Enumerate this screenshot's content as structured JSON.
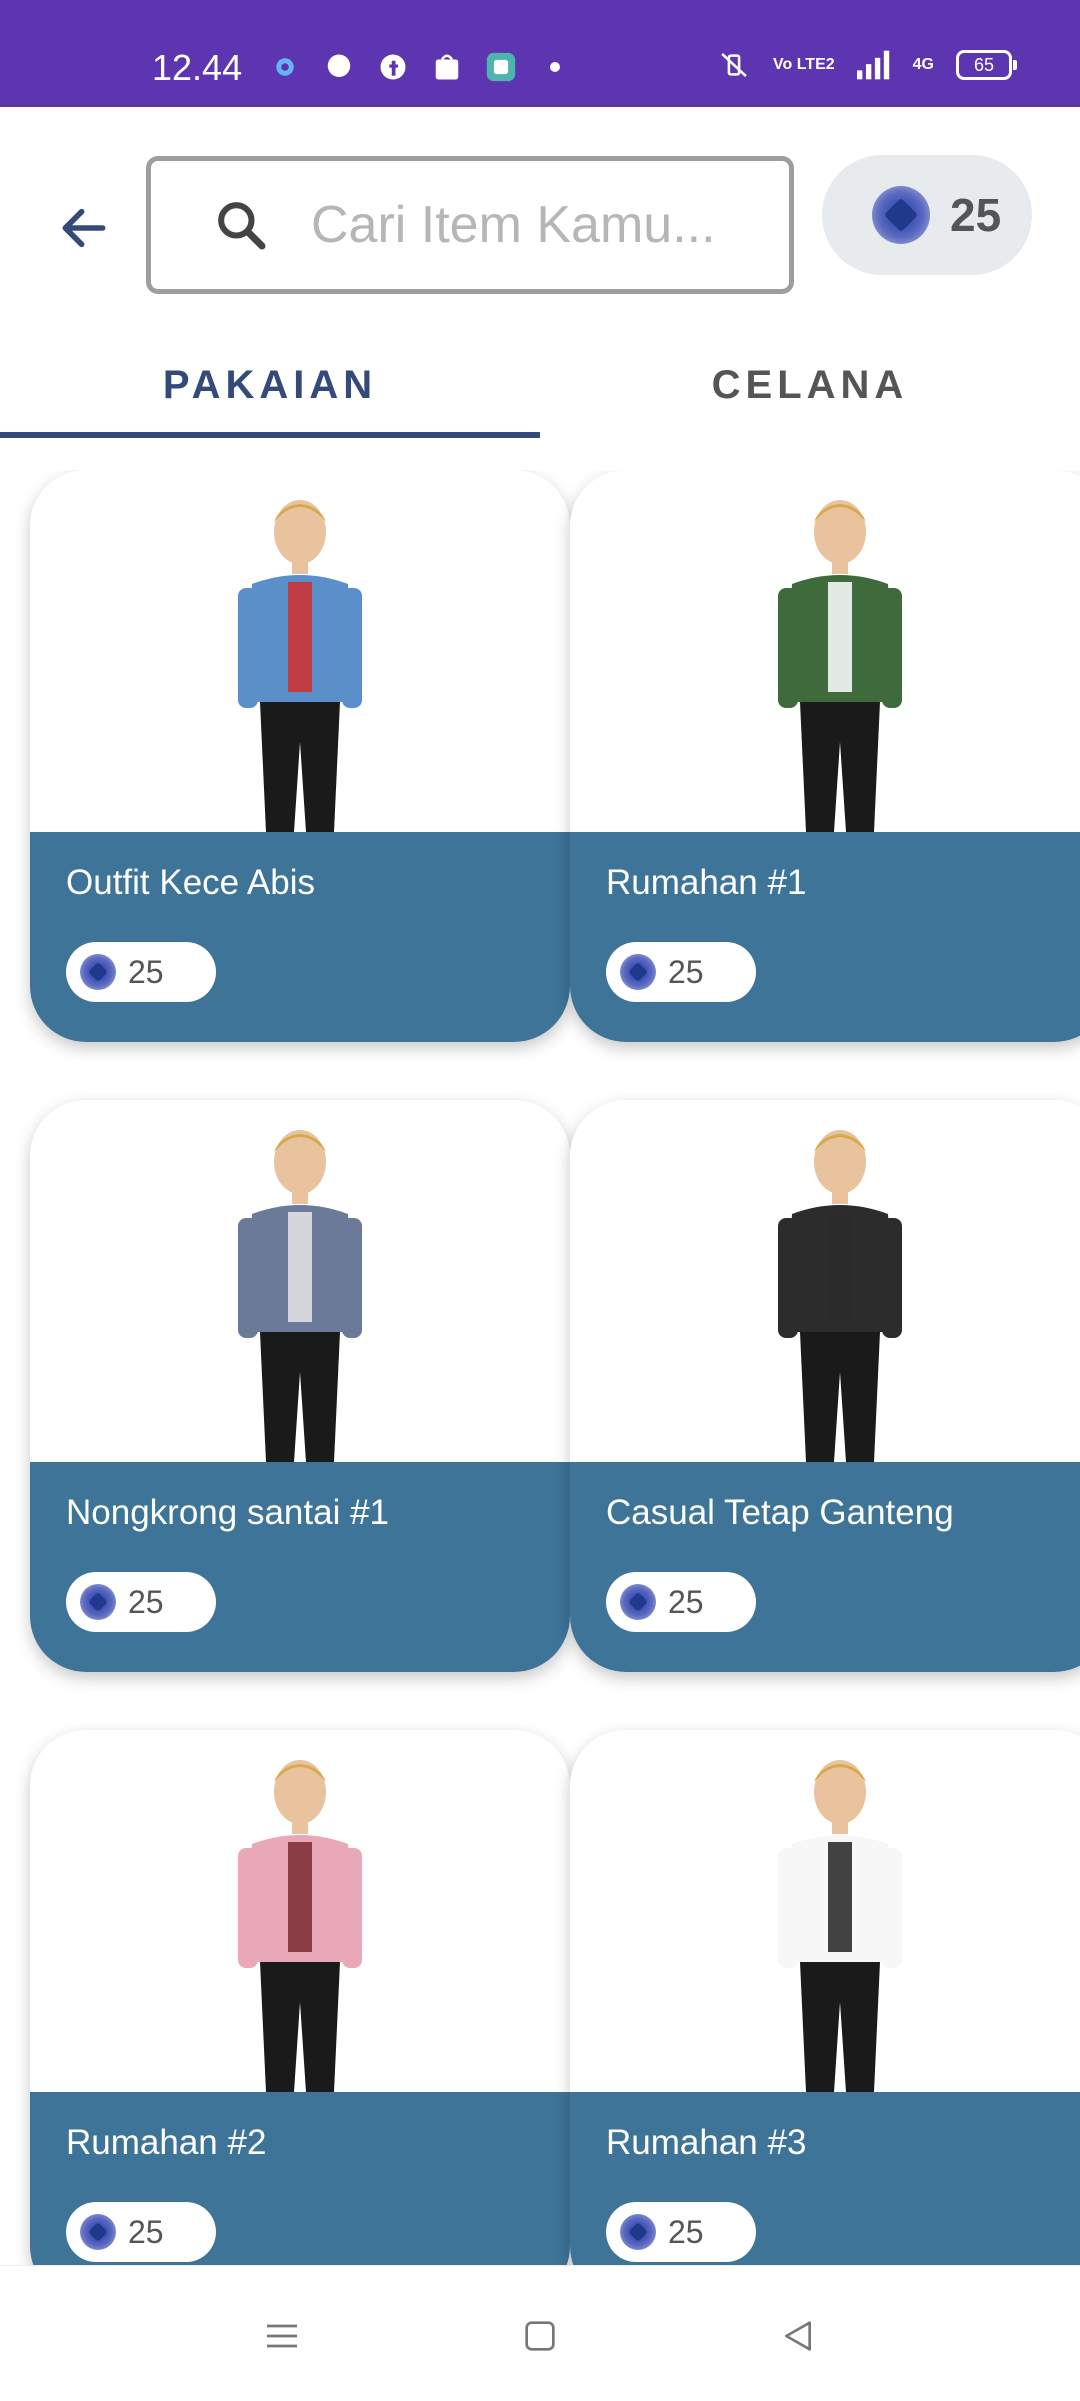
{
  "status_bar": {
    "time": "12.44",
    "battery": "65",
    "network": "4G",
    "volte": "Vo LTE2"
  },
  "header": {
    "search_placeholder": "Cari Item Kamu...",
    "coin_balance": "25"
  },
  "tabs": [
    {
      "label": "PAKAIAN",
      "active": true
    },
    {
      "label": "CELANA",
      "active": false
    }
  ],
  "items": [
    {
      "title": "Outfit Kece Abis",
      "price": "25",
      "top_color": "#5b8fc9",
      "bottom_color": "#1a1a1a",
      "accent": "#d32f2f"
    },
    {
      "title": "Rumahan #1",
      "price": "25",
      "top_color": "#3f6b3c",
      "bottom_color": "#1a1a1a",
      "accent": "#ffffff"
    },
    {
      "title": "Nongkrong santai #1",
      "price": "25",
      "top_color": "#6b7a99",
      "bottom_color": "#1a1a1a",
      "accent": "#e6e6e6"
    },
    {
      "title": "Casual Tetap Ganteng",
      "price": "25",
      "top_color": "#2c2c2c",
      "bottom_color": "#1a1a1a",
      "accent": "#2c2c2c"
    },
    {
      "title": "Rumahan #2",
      "price": "25",
      "top_color": "#e8a8b8",
      "bottom_color": "#1a1a1a",
      "accent": "#7a2b30"
    },
    {
      "title": "Rumahan #3",
      "price": "25",
      "top_color": "#f7f7f7",
      "bottom_color": "#1a1a1a",
      "accent": "#222222"
    }
  ],
  "colors": {
    "status_bar": "#5e35b1",
    "accent": "#344a7a",
    "card_info": "#3d7497"
  }
}
